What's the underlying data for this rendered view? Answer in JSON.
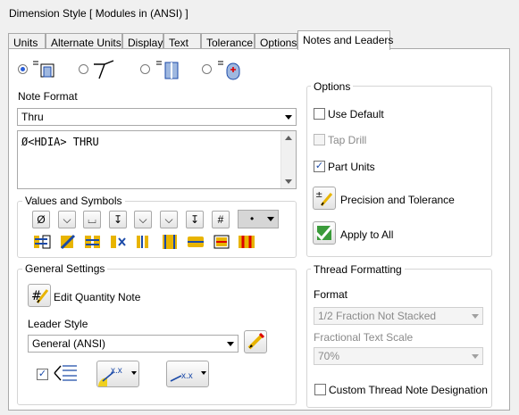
{
  "window": {
    "title": "Dimension Style [ Modules in (ANSI) ]"
  },
  "tabs": [
    {
      "label": "Units"
    },
    {
      "label": "Alternate Units"
    },
    {
      "label": "Display"
    },
    {
      "label": "Text"
    },
    {
      "label": "Tolerance"
    },
    {
      "label": "Options"
    },
    {
      "label": "Notes and Leaders"
    }
  ],
  "note_format": {
    "label": "Note Format",
    "selected": "Thru",
    "text": "Ø<HDIA> THRU"
  },
  "values_symbols": {
    "title": "Values and Symbols",
    "row1": [
      "diameter-symbol",
      "countersink-symbol",
      "counterbore-symbol",
      "depth-symbol",
      "spotface-symbol",
      "tapered-symbol",
      "thread-depth-symbol",
      "hash-symbol"
    ],
    "row1_glyphs": [
      "Ø",
      "⌵",
      "⌴",
      "↧",
      "⌵",
      "⌵",
      "↧",
      "#"
    ],
    "dropdown_value": "•",
    "row2": [
      "value-1",
      "value-2",
      "value-3",
      "value-4",
      "value-5",
      "value-6",
      "value-7",
      "value-8",
      "value-9"
    ]
  },
  "general": {
    "title": "General Settings",
    "edit_quantity_note": "Edit Quantity Note",
    "leader_style_label": "Leader Style",
    "leader_style_value": "General (ANSI)",
    "leader_checkbox_checked": true,
    "arrow_label_1": "x.x",
    "arrow_label_2": "x.x"
  },
  "options": {
    "title": "Options",
    "use_default": "Use Default",
    "use_default_checked": false,
    "tap_drill": "Tap Drill",
    "tap_drill_checked": false,
    "part_units": "Part Units",
    "part_units_checked": true,
    "precision": "Precision and Tolerance",
    "apply_all": "Apply to All"
  },
  "thread": {
    "title": "Thread Formatting",
    "format_label": "Format",
    "format_value": "1/2 Fraction Not Stacked",
    "fractional_scale_label": "Fractional Text Scale",
    "fractional_scale_value": "70%",
    "custom_label": "Custom Thread Note Designation",
    "custom_checked": false
  },
  "colors": {
    "accent": "#2a5ed8",
    "border": "#a9a9a9",
    "background": "#f0f0f0"
  }
}
